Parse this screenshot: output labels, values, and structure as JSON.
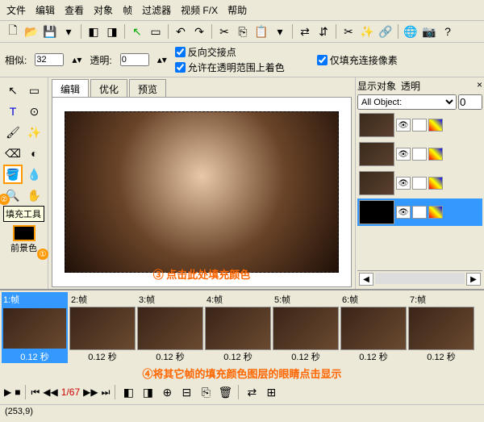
{
  "menu": [
    "文件",
    "编辑",
    "查看",
    "对象",
    "帧",
    "过滤器",
    "视频 F/X",
    "帮助"
  ],
  "optbar": {
    "label1": "相似:",
    "val1": "32",
    "label2": "透明:",
    "val2": "0",
    "chk1": "反向交接点",
    "chk2": "允许在透明范围上着色",
    "chk3": "仅填充连接像素"
  },
  "tabs": {
    "t1": "编辑",
    "t2": "优化",
    "t3": "预览"
  },
  "left": {
    "hint": "填充工具",
    "swatch_label": "前景色"
  },
  "right": {
    "h1": "显示对象",
    "h2": "透明",
    "select": "All Object:",
    "spin": "0"
  },
  "frames": [
    {
      "label": "1:帧",
      "dur": "0.12 秒"
    },
    {
      "label": "2:帧",
      "dur": "0.12 秒"
    },
    {
      "label": "3:帧",
      "dur": "0.12 秒"
    },
    {
      "label": "4:帧",
      "dur": "0.12 秒"
    },
    {
      "label": "5:帧",
      "dur": "0.12 秒"
    },
    {
      "label": "6:帧",
      "dur": "0.12 秒"
    },
    {
      "label": "7:帧",
      "dur": "0.12 秒"
    }
  ],
  "timeline": {
    "counter": "1/67"
  },
  "status": "(253,9)",
  "annotations": {
    "a1": "①",
    "a2": "②",
    "a3": "③ 点击此处填充颜色",
    "a4": "④将其它帧的填充颜色图层的眼睛点击显示"
  }
}
